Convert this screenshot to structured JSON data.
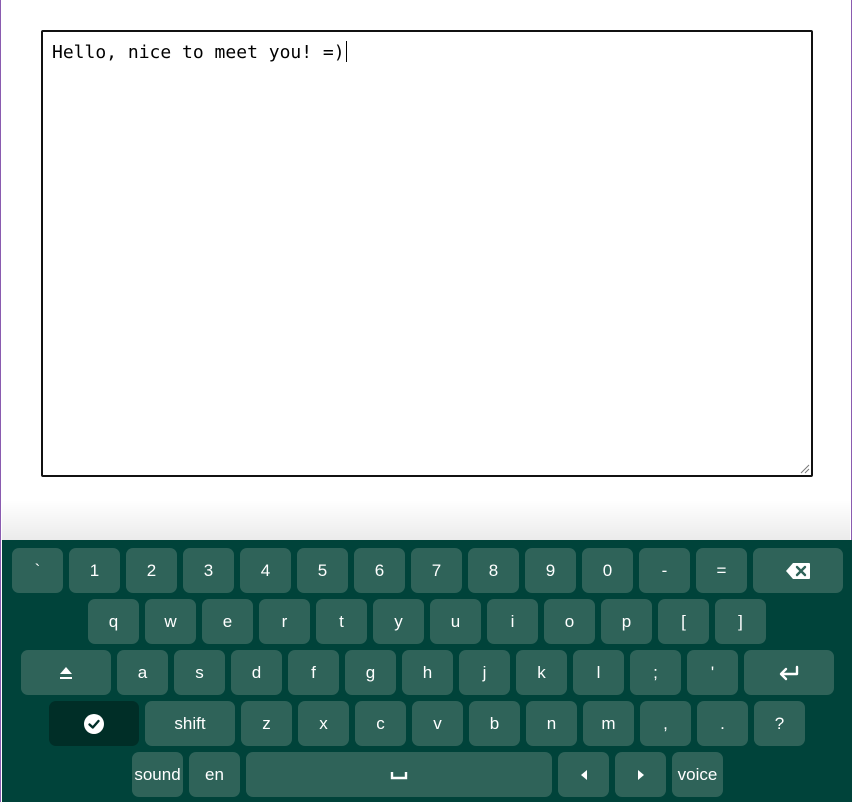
{
  "editor": {
    "text": "Hello, nice to meet you! =)"
  },
  "keyboard": {
    "colors": {
      "background": "#00433a",
      "key": "#2f6359",
      "key_active": "#002e27",
      "label": "#ffffff"
    },
    "row1": [
      "`",
      "1",
      "2",
      "3",
      "4",
      "5",
      "6",
      "7",
      "8",
      "9",
      "0",
      "-",
      "="
    ],
    "row2": [
      "q",
      "w",
      "e",
      "r",
      "t",
      "y",
      "u",
      "i",
      "o",
      "p",
      "[",
      "]"
    ],
    "row3": [
      "a",
      "s",
      "d",
      "f",
      "g",
      "h",
      "j",
      "k",
      "l",
      ";",
      "'"
    ],
    "row4": [
      "z",
      "x",
      "c",
      "v",
      "b",
      "n",
      "m",
      ",",
      ".",
      "?"
    ],
    "shift_label": "shift",
    "sound_label": "sound",
    "lang_label": "en",
    "voice_label": "voice",
    "icons": {
      "backspace": "backspace-icon",
      "caps": "caps-lock-icon",
      "enter": "enter-icon",
      "done": "checkmark-icon",
      "space": "space-icon",
      "left": "arrow-left-icon",
      "right": "arrow-right-icon"
    }
  }
}
